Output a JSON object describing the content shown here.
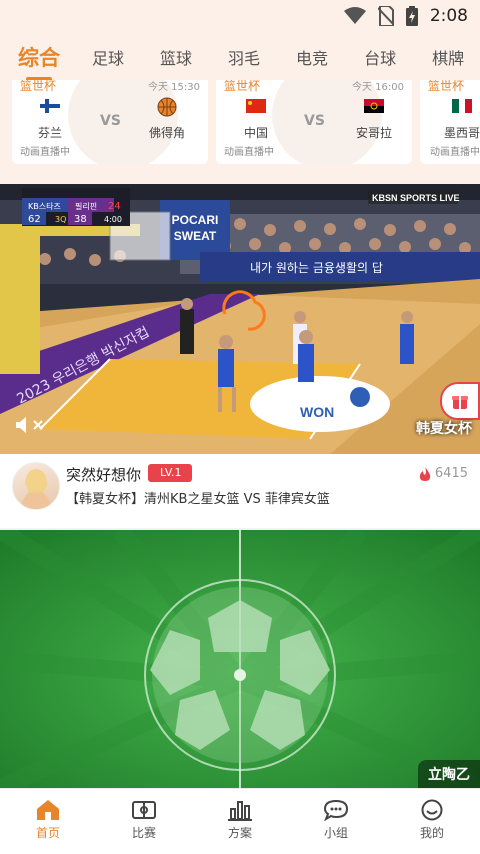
{
  "status": {
    "time": "2:08"
  },
  "nav": {
    "tabs": [
      "综合",
      "足球",
      "篮球",
      "羽毛",
      "电竞",
      "台球",
      "棋牌"
    ]
  },
  "matches": [
    {
      "league": "篮世杯",
      "time": "今天 15:30",
      "team1": "芬兰",
      "team2": "佛得角",
      "vs": "VS",
      "status": "动画直播中"
    },
    {
      "league": "篮世杯",
      "time": "今天 16:00",
      "team1": "中国",
      "team2": "安哥拉",
      "vs": "VS",
      "status": "动画直播中"
    },
    {
      "league": "篮世杯",
      "time": "",
      "team1": "墨西哥",
      "team2": "",
      "vs": "",
      "status": "动画直播中"
    }
  ],
  "video": {
    "title": "韩夏女杯",
    "scoreboard": {
      "team1": "KB스타즈",
      "team2": "필리핀",
      "score1": "62",
      "score2": "38",
      "quarter": "3Q",
      "period_score": "24",
      "clock": "4:00"
    },
    "broadcaster": "KBSN SPORTS LIVE",
    "court_logo": "WON",
    "banner": "내가 원하는 금융생활의 답"
  },
  "live": {
    "streamer": "突然好想你",
    "level": "LV.1",
    "viewers": "6415",
    "title": "【韩夏女杯】清州KB之星女篮 VS 菲律宾女篮"
  },
  "field": {
    "label": "立陶乙"
  },
  "bottom_nav": {
    "items": [
      "首页",
      "比赛",
      "方案",
      "小组",
      "我的"
    ]
  },
  "colors": {
    "accent": "#e8852b",
    "badge": "#e8434b",
    "field": "#2f9b3a",
    "header_bg": "#fdf0e8"
  }
}
